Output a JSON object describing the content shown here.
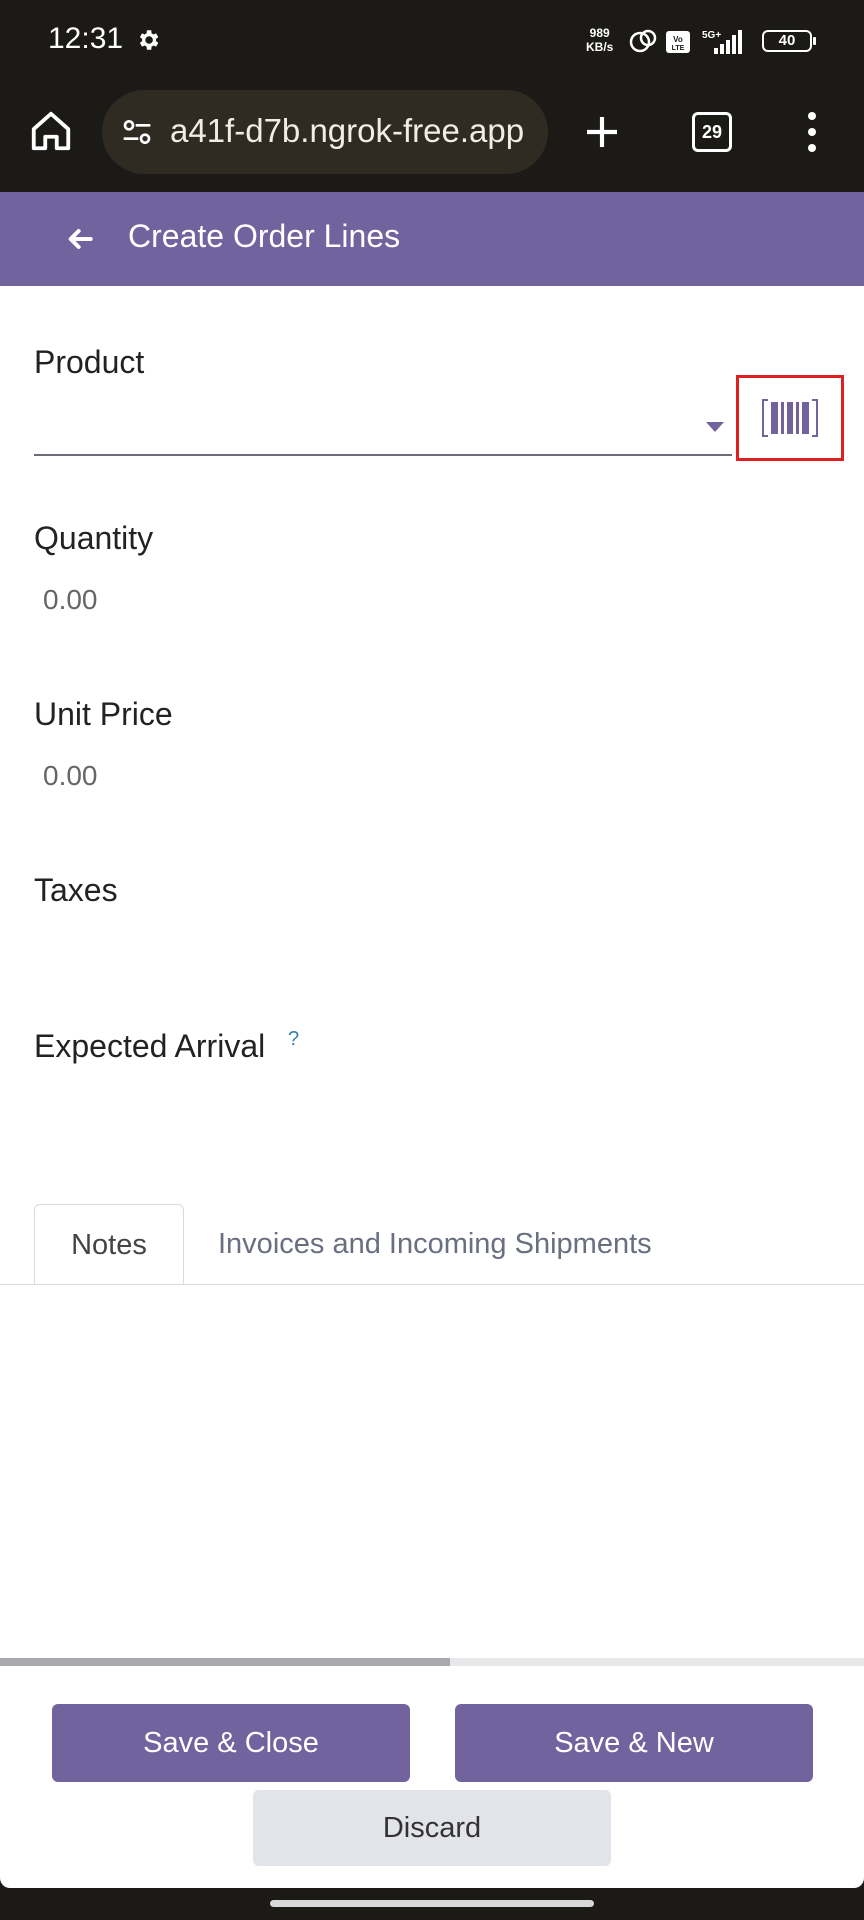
{
  "status_bar": {
    "time": "12:31",
    "net_speed_value": "989",
    "net_speed_unit": "KB/s",
    "battery": "40",
    "icons": [
      "gear-icon",
      "hotspot-icon",
      "volte-icon",
      "5g-icon",
      "signal-icon",
      "battery-icon"
    ]
  },
  "browser": {
    "url": "a41f-d7b.ngrok-free.app",
    "tab_count": "29"
  },
  "header": {
    "title": "Create Order Lines"
  },
  "form": {
    "product_label": "Product",
    "quantity_label": "Quantity",
    "quantity_value": "0.00",
    "unit_price_label": "Unit Price",
    "unit_price_value": "0.00",
    "taxes_label": "Taxes",
    "expected_arrival_label": "Expected Arrival",
    "help_mark": "?"
  },
  "tabs": [
    {
      "label": "Notes"
    },
    {
      "label": "Invoices and Incoming Shipments"
    }
  ],
  "footer": {
    "save_close": "Save & Close",
    "save_new": "Save & New",
    "discard": "Discard"
  },
  "colors": {
    "brand": "#71639e",
    "highlight": "#e02020"
  }
}
